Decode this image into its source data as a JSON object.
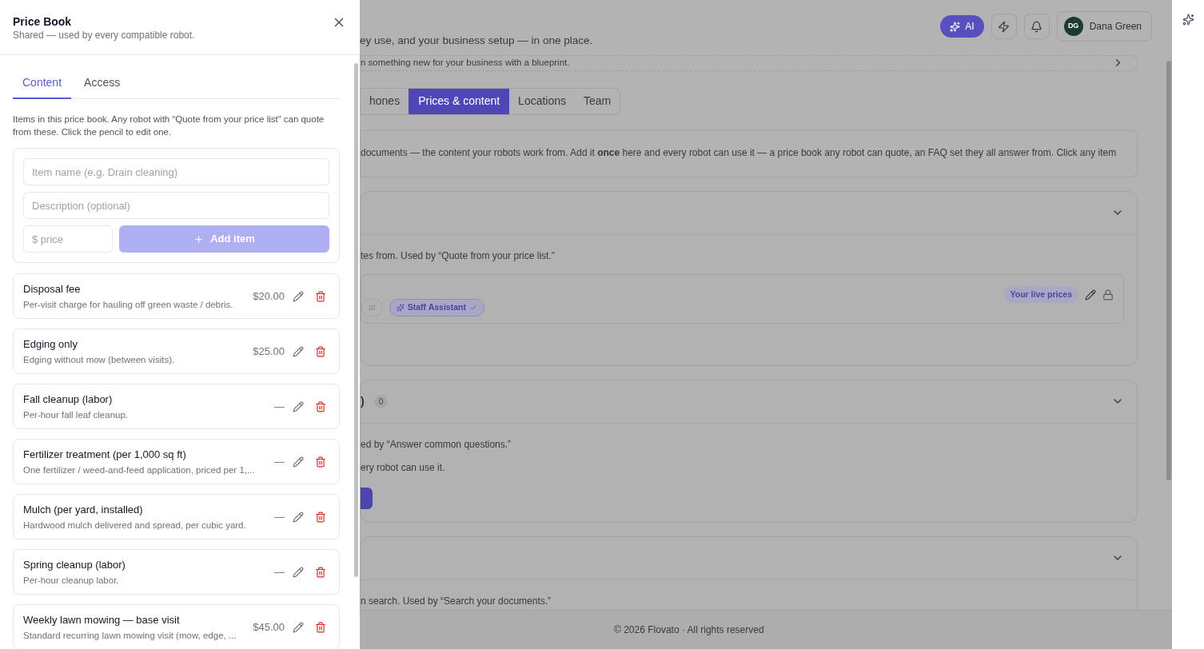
{
  "drawer": {
    "title": "Price Book",
    "subtitle": "Shared — used by every compatible robot.",
    "tabs": [
      {
        "label": "Content",
        "selected": true
      },
      {
        "label": "Access",
        "selected": false
      }
    ],
    "intro": "Items in this price book. Any robot with “Quote from your price list” can quote from these. Click the pencil to edit one.",
    "form": {
      "name_placeholder": "Item name (e.g. Drain cleaning)",
      "description_placeholder": "Description (optional)",
      "price_placeholder": "$ price",
      "add_button": {
        "label": "Add item",
        "disabled": true
      }
    },
    "items": [
      {
        "name": "Disposal fee",
        "description": "Per-visit charge for hauling off green waste / debris.",
        "price": "$20.00"
      },
      {
        "name": "Edging only",
        "description": "Edging without mow (between visits).",
        "price": "$25.00"
      },
      {
        "name": "Fall cleanup (labor)",
        "description": "Per-hour fall leaf cleanup.",
        "price": "—"
      },
      {
        "name": "Fertilizer treatment (per 1,000 sq ft)",
        "description": "One fertilizer / weed-and-feed application, priced per 1,...",
        "price": "—"
      },
      {
        "name": "Mulch (per yard, installed)",
        "description": "Hardwood mulch delivered and spread, per cubic yard.",
        "price": "—"
      },
      {
        "name": "Spring cleanup (labor)",
        "description": "Per-hour cleanup labor.",
        "price": "—"
      },
      {
        "name": "Weekly lawn mowing — base visit",
        "description": "Standard recurring lawn mowing visit (mow, edge, ...",
        "price": "$45.00"
      }
    ]
  },
  "page": {
    "subtitle": "ey use, and your business setup — in one place.",
    "header": {
      "ai_button": "AI",
      "user": {
        "initials": "DG",
        "name": "Dana Green"
      }
    },
    "blueprint_banner": "n something new for your business with a blueprint.",
    "tabs": [
      {
        "label": "hones",
        "selected": false
      },
      {
        "label": "Prices & content",
        "selected": true
      },
      {
        "label": "Locations",
        "selected": false
      },
      {
        "label": "Team",
        "selected": false
      }
    ],
    "info": "documents — the content your robots work from. Add it **once** here and every robot can use it — a price book any robot can quote, an FAQ set they all answer from. Click any item",
    "sections": [
      {
        "expanded": true,
        "lines": [
          "tes from. Used by “Quote from your price list.”"
        ],
        "resource": {
          "chips": [
            {
              "label": "at",
              "selected": false
            },
            {
              "label": "Staff Assistant",
              "selected": true
            }
          ],
          "badge": "Your live prices"
        }
      },
      {
        "expanded": true,
        "title": ")",
        "count": "0",
        "lines": [
          "ed by “Answer common questions.”",
          "ery robot can use it."
        ],
        "button": true
      },
      {
        "expanded": true,
        "lines": [
          "n search. Used by “Search your documents.”"
        ]
      }
    ],
    "footer": "© 2026 Flovato · All rights reserved"
  }
}
